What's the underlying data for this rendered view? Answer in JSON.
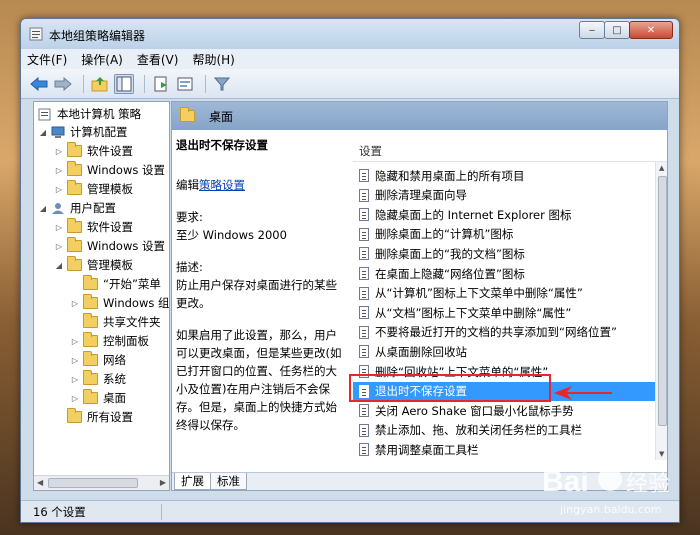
{
  "window": {
    "title": "本地组策略编辑器",
    "min_symbol": "‒",
    "max_symbol": "□",
    "close_symbol": "✕"
  },
  "menu": [
    "文件(F)",
    "操作(A)",
    "查看(V)",
    "帮助(H)"
  ],
  "tree": {
    "root": "本地计算机 策略",
    "computer_config": "计算机配置",
    "cc_software": "软件设置",
    "cc_windows": "Windows 设置",
    "cc_admin": "管理模板",
    "user_config": "用户配置",
    "uc_software": "软件设置",
    "uc_windows": "Windows 设置",
    "uc_admin": "管理模板",
    "start_menu": "“开始”菜单",
    "windows_components": "Windows 组件",
    "shared_folder": "共享文件夹",
    "control_panel": "控制面板",
    "network": "网络",
    "system": "系统",
    "desktop": "桌面",
    "all_settings": "所有设置"
  },
  "right": {
    "header": "桌面",
    "column_header": "设置"
  },
  "description": {
    "title": "退出时不保存设置",
    "edit_prefix": "编辑",
    "edit_link": "策略设置",
    "req_label": "要求:",
    "req_value": "至少 Windows 2000",
    "desc_label": "描述:",
    "desc_text": "防止用户保存对桌面进行的某些更改。",
    "details": "如果启用了此设置，那么，用户可以更改桌面，但是某些更改(如已打开窗口的位置、任务栏的大小及位置)在用户注销后不会保存。但是，桌面上的快捷方式始终得以保存。"
  },
  "settings": [
    "隐藏和禁用桌面上的所有项目",
    "删除清理桌面向导",
    "隐藏桌面上的 Internet Explorer 图标",
    "删除桌面上的“计算机”图标",
    "删除桌面上的“我的文档”图标",
    "在桌面上隐藏“网络位置”图标",
    "从“计算机”图标上下文菜单中删除“属性”",
    "从“文档”图标上下文菜单中删除“属性”",
    "不要将最近打开的文档的共享添加到“网络位置”",
    "从桌面删除回收站",
    "删除“回收站”上下文菜单的“属性”",
    "退出时不保存设置",
    "关闭 Aero Shake 窗口最小化鼠标手势",
    "禁止添加、拖、放和关闭任务栏的工具栏",
    "禁用调整桌面工具栏"
  ],
  "selected_index": 11,
  "tabs": [
    "扩展",
    "标准"
  ],
  "status": "16 个设置",
  "watermark": {
    "brand": "Bai",
    "brand2": "经验",
    "url": "jingyan.baidu.com"
  },
  "colors": {
    "selection": "#3399ff",
    "highlight": "#e8262b",
    "link": "#0046b4"
  }
}
